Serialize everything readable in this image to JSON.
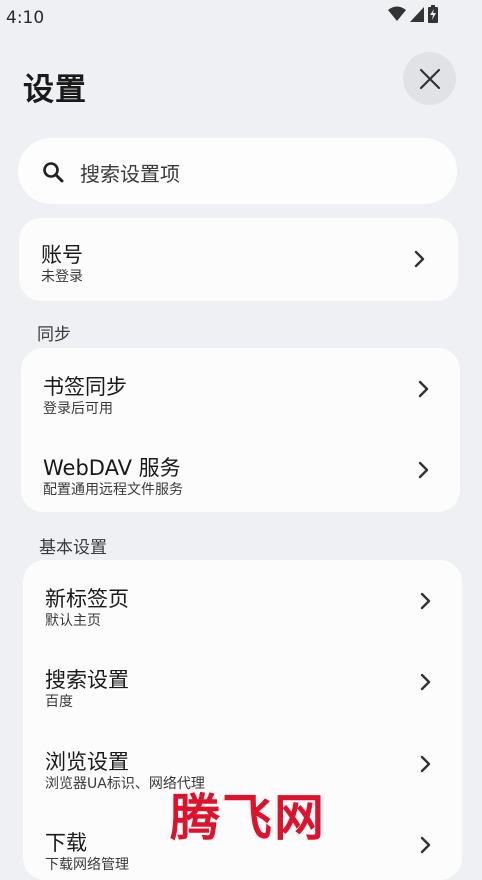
{
  "status_bar": {
    "time": "4:10",
    "icons": [
      "wifi-icon",
      "signal-icon",
      "battery-icon"
    ]
  },
  "header": {
    "title": "设置",
    "close_icon": "close-icon"
  },
  "search": {
    "placeholder": "搜索设置项",
    "icon": "search-icon"
  },
  "account": {
    "title": "账号",
    "subtitle": "未登录"
  },
  "sections": [
    {
      "header": "同步",
      "items": [
        {
          "title": "书签同步",
          "subtitle": "登录后可用"
        },
        {
          "title": "WebDAV 服务",
          "subtitle": "配置通用远程文件服务"
        }
      ]
    },
    {
      "header": "基本设置",
      "items": [
        {
          "title": "新标签页",
          "subtitle": "默认主页"
        },
        {
          "title": "搜索设置",
          "subtitle": "百度"
        },
        {
          "title": "浏览设置",
          "subtitle": "浏览器UA标识、网络代理"
        },
        {
          "title": "下载",
          "subtitle": "下载网络管理"
        }
      ]
    }
  ],
  "watermark": {
    "text": "腾飞网"
  },
  "colors": {
    "background": "#eff0f4",
    "card": "#fcfcfc",
    "watermark": "#e0112b"
  }
}
